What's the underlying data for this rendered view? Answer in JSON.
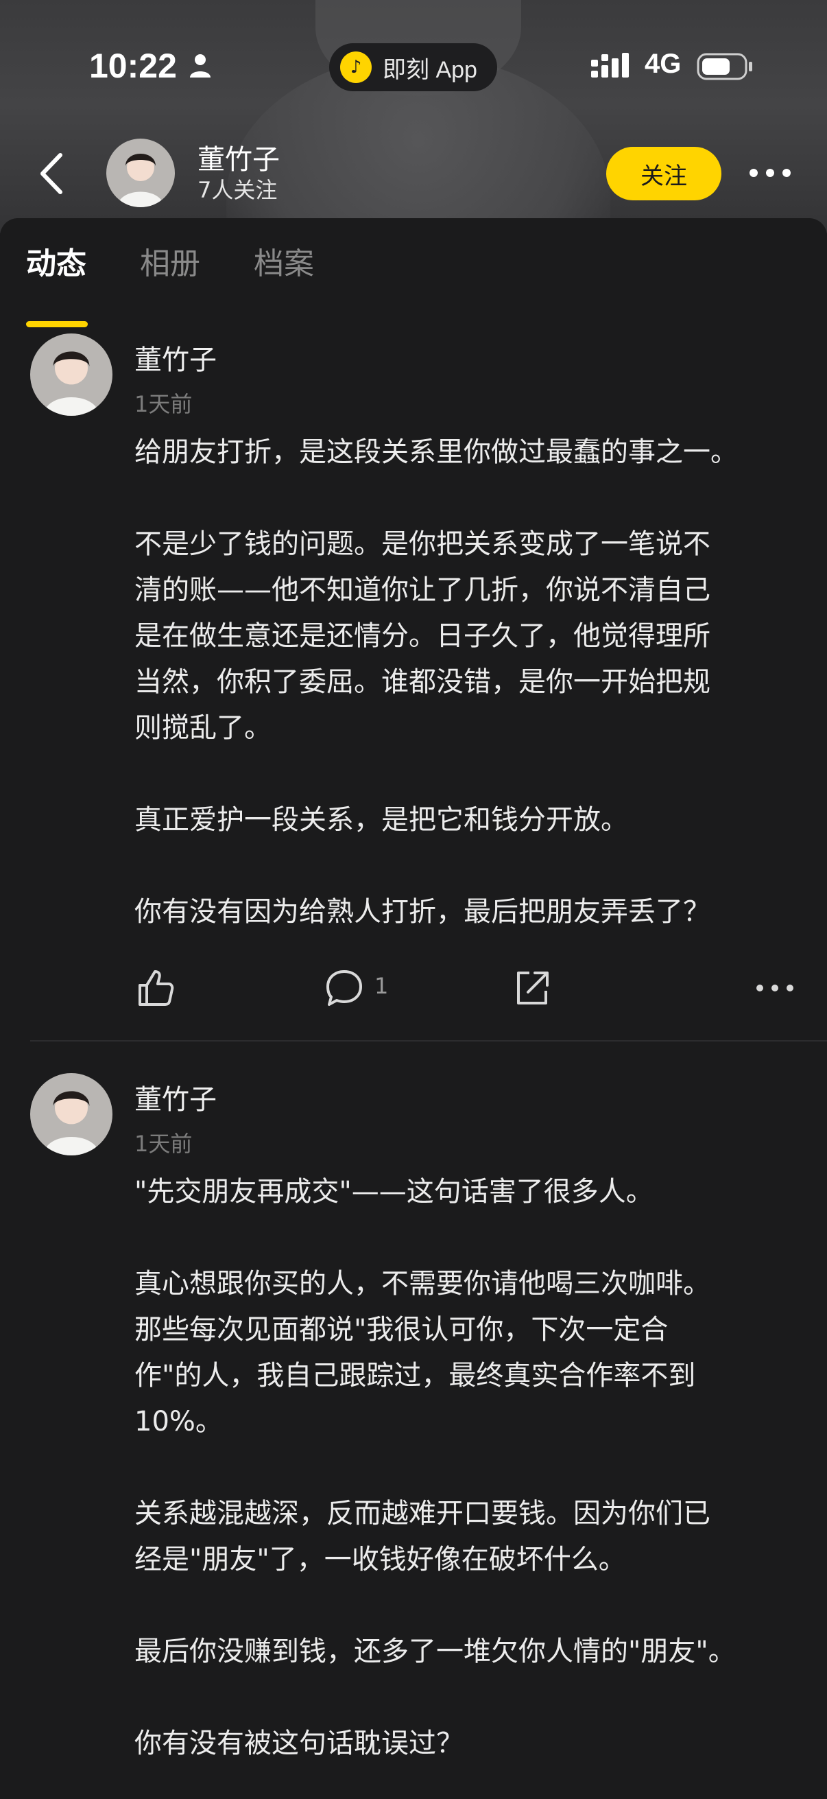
{
  "status_bar": {
    "time": "10:22",
    "app_pill_label": "即刻 App",
    "network": "4G"
  },
  "header": {
    "name": "董竹子",
    "followers": "7人关注",
    "follow_label": "关注"
  },
  "tabs": [
    {
      "label": "动态",
      "active": true
    },
    {
      "label": "相册",
      "active": false
    },
    {
      "label": "档案",
      "active": false
    }
  ],
  "posts": [
    {
      "author": "董竹子",
      "time": "1天前",
      "paragraphs": [
        "给朋友打折，是这段关系里你做过最蠢的事之一。",
        "不是少了钱的问题。是你把关系变成了一笔说不\n清的账——他不知道你让了几折，你说不清自己\n是在做生意还是还情分。日子久了，他觉得理所\n当然，你积了委屈。谁都没错，是你一开始把规\n则搅乱了。",
        "真正爱护一段关系，是把它和钱分开放。",
        "你有没有因为给熟人打折，最后把朋友弄丢了？"
      ],
      "comment_count": "1"
    },
    {
      "author": "董竹子",
      "time": "1天前",
      "paragraphs": [
        "\"先交朋友再成交\"——这句话害了很多人。",
        "真心想跟你买的人，不需要你请他喝三次咖啡。\n那些每次见面都说\"我很认可你，下次一定合\n作\"的人，我自己跟踪过，最终真实合作率不到\n10%。",
        "关系越混越深，反而越难开口要钱。因为你们已\n经是\"朋友\"了，一收钱好像在破坏什么。",
        "最后你没赚到钱，还多了一堆欠你人情的\"朋友\"。",
        "你有没有被这句话耽误过？"
      ]
    }
  ],
  "icons": [
    "person-icon",
    "signal-icon",
    "battery-icon",
    "back-icon",
    "more-icon",
    "like-icon",
    "comment-icon",
    "share-icon"
  ],
  "colors": {
    "accent": "#ffd400",
    "background": "#1b1b1c",
    "text": "#ececec",
    "muted": "#7c7c7c"
  }
}
